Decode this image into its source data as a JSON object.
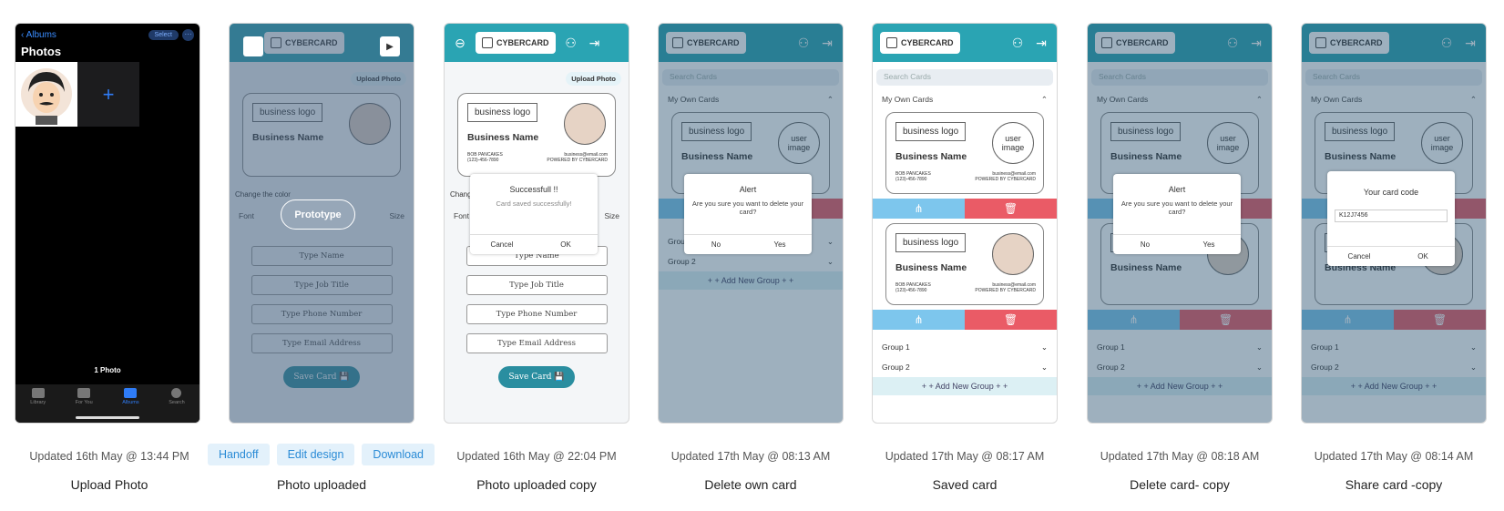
{
  "actions": {
    "handoff": "Handoff",
    "edit_design": "Edit design",
    "download": "Download"
  },
  "screens": [
    {
      "title": "Upload Photo",
      "updated": "Updated 16th May @ 13:44 PM"
    },
    {
      "title": "Photo uploaded",
      "updated": ""
    },
    {
      "title": "Photo uploaded copy",
      "updated": "Updated 16th May @ 22:04 PM"
    },
    {
      "title": "Delete own card",
      "updated": "Updated 17th May @ 08:13 AM"
    },
    {
      "title": "Saved card",
      "updated": "Updated 17th May @ 08:17 AM"
    },
    {
      "title": "Delete card- copy",
      "updated": "Updated 17th May @ 08:18 AM"
    },
    {
      "title": "Share card -copy",
      "updated": "Updated 17th May @ 08:14 AM"
    }
  ],
  "photos": {
    "back": "Albums",
    "select": "Select",
    "more": "···",
    "heading": "Photos",
    "count": "1 Photo",
    "tabs": [
      "Library",
      "For You",
      "Albums",
      "Search"
    ]
  },
  "prototype": {
    "label": "Prototype"
  },
  "app": {
    "brand": "CYBERCARD",
    "search_placeholder": "Search Cards",
    "my_cards": "My Own Cards",
    "business_logo": "business logo",
    "business_name": "Business Name",
    "user_image": "user image",
    "contact_name": "BOB PANCAKES",
    "contact_phone": "(123)-456-7890",
    "contact_email": "business@email.com",
    "powered": "POWERED BY CYBERCARD",
    "group1": "Group 1",
    "group2": "Group 2",
    "add_group": "+ + Add New Group + +",
    "upload_photo": "Upload Photo",
    "change_color": "Change the color",
    "font": "Font",
    "size": "Size",
    "fields": [
      "Type Name",
      "Type Job Title",
      "Type Phone Number",
      "Type Email Address"
    ],
    "save_card": "Save Card"
  },
  "dialogs": {
    "success_title": "Successfull !!",
    "success_msg": "Card saved successfully!",
    "cancel": "Cancel",
    "ok": "OK",
    "alert_title": "Alert",
    "alert_msg": "Are you sure you want to delete your card?",
    "no": "No",
    "yes": "Yes",
    "code_title": "Your card code",
    "code_value": "K12J7456"
  }
}
